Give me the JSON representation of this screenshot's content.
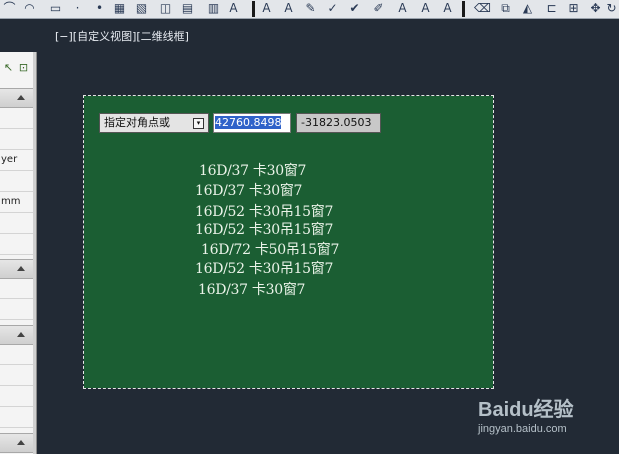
{
  "viewport": {
    "label": "[−][自定义视图][二维线框]"
  },
  "palette": {
    "rows": [
      "",
      "yer",
      "",
      " mm",
      ""
    ]
  },
  "command": {
    "prompt": "指定对角点或",
    "x_value": "42760.8498",
    "y_value": "-31823.0503"
  },
  "drawing": {
    "lines": [
      "16D/37  卡30窗7",
      "16D/37  卡30窗7",
      "16D/52  卡30吊15窗7",
      "16D/52  卡30吊15窗7",
      "16D/72  卡50吊15窗7",
      "16D/52  卡30吊15窗7",
      "16D/37  卡30窗7"
    ]
  },
  "watermark": {
    "logo": "Baidu经验",
    "url": "jingyan.baidu.com"
  },
  "colors": {
    "canvas_bg": "#222a35",
    "region_fill": "#1b5e33",
    "selection_blue": "#2f62c9"
  }
}
